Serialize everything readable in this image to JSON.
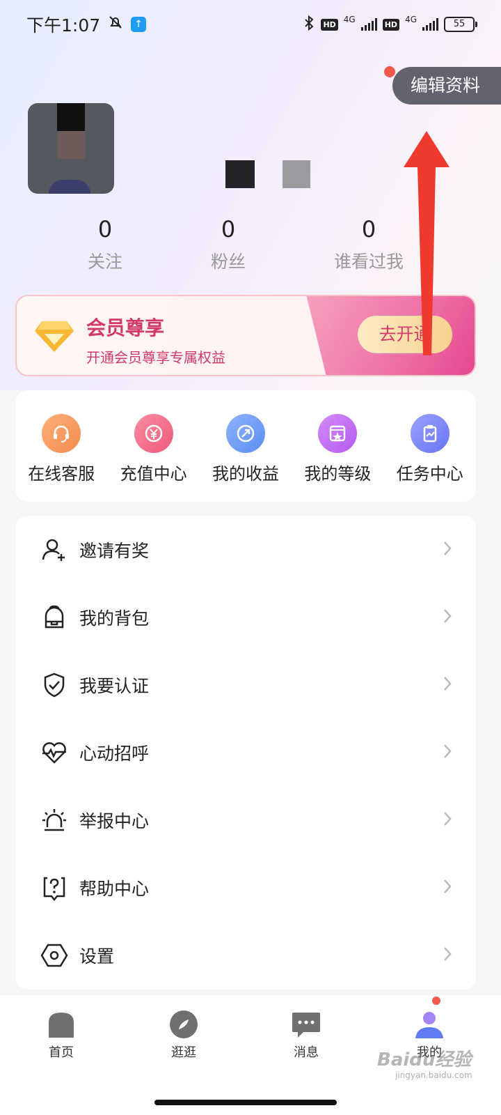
{
  "status_bar": {
    "time": "下午1:07",
    "battery": "55",
    "network_label": "4G",
    "hd_label": "HD"
  },
  "profile": {
    "edit_label": "编辑资料",
    "stats": [
      {
        "value": "0",
        "label": "关注"
      },
      {
        "value": "0",
        "label": "粉丝"
      },
      {
        "value": "0",
        "label": "谁看过我"
      }
    ]
  },
  "vip": {
    "title": "会员尊享",
    "subtitle": "开通会员尊享专属权益",
    "button_label": "去开通"
  },
  "shortcuts": [
    {
      "label": "在线客服",
      "icon": "headset-icon",
      "color": "#f58a4e"
    },
    {
      "label": "充值中心",
      "icon": "yen-icon",
      "color": "#ef5a7a"
    },
    {
      "label": "我的收益",
      "icon": "income-icon",
      "color": "#5b8ef5"
    },
    {
      "label": "我的等级",
      "icon": "level-icon",
      "color": "#b45bf0"
    },
    {
      "label": "任务中心",
      "icon": "task-icon",
      "color": "#6a73f5"
    }
  ],
  "menu": [
    {
      "label": "邀请有奖",
      "icon": "invite-user-icon"
    },
    {
      "label": "我的背包",
      "icon": "backpack-icon"
    },
    {
      "label": "我要认证",
      "icon": "shield-check-icon"
    },
    {
      "label": "心动招呼",
      "icon": "heartbeat-icon"
    },
    {
      "label": "举报中心",
      "icon": "alarm-icon"
    },
    {
      "label": "帮助中心",
      "icon": "help-icon"
    },
    {
      "label": "设置",
      "icon": "settings-hex-icon"
    }
  ],
  "tabs": [
    {
      "label": "首页",
      "icon": "home-icon"
    },
    {
      "label": "逛逛",
      "icon": "compass-icon"
    },
    {
      "label": "消息",
      "icon": "chat-icon"
    },
    {
      "label": "我的",
      "icon": "profile-icon"
    }
  ],
  "watermark": {
    "text": "Baidu经验",
    "sub": "jingyan.baidu.com"
  },
  "colors": {
    "accent_pink": "#d2386a",
    "edit_bg": "#636370",
    "arrow_red": "#f03a2e",
    "active_tab": "#5f7cf5"
  }
}
